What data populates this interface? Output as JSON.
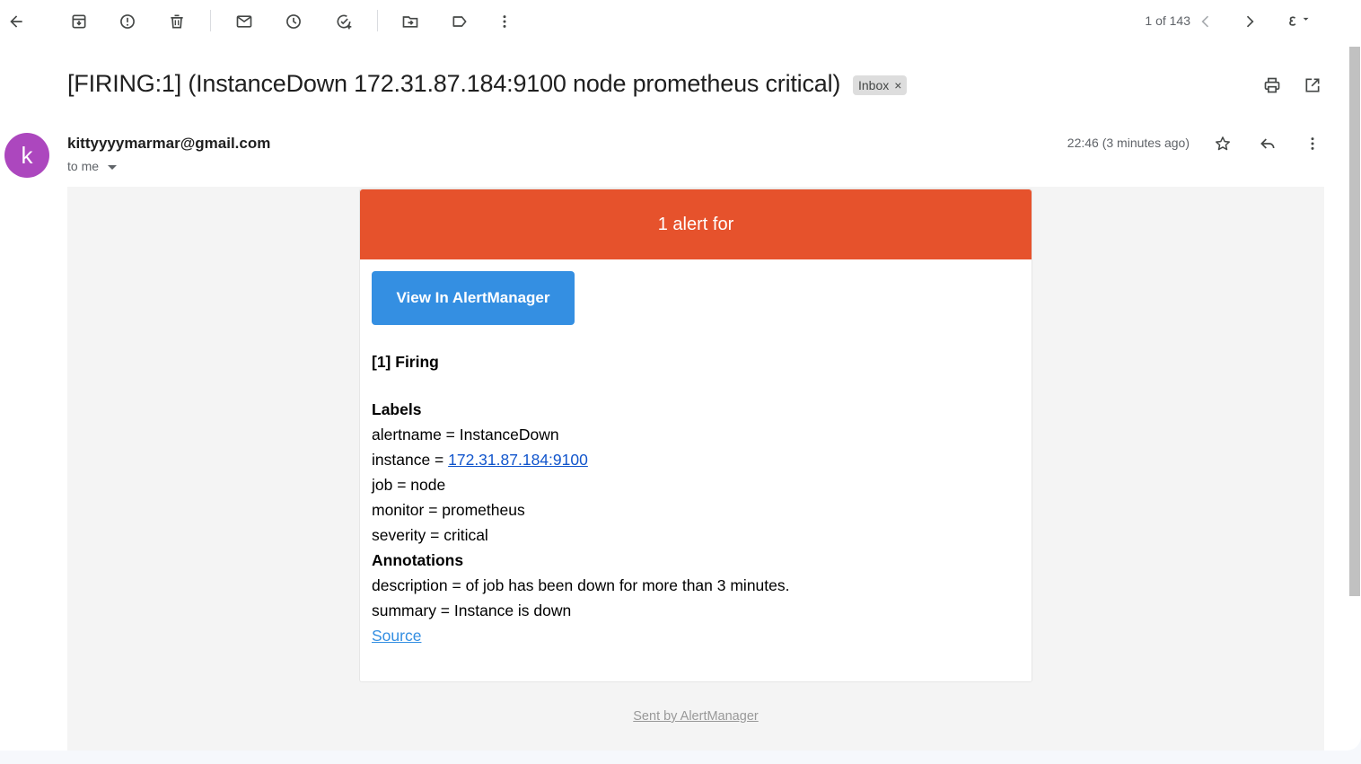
{
  "toolbar": {
    "pager": "1 of 143",
    "icons": [
      "back-arrow-icon",
      "archive-icon",
      "report-spam-icon",
      "delete-icon",
      "mark-unread-icon",
      "snooze-icon",
      "add-task-icon",
      "move-to-icon",
      "label-icon",
      "more-vert-icon",
      "chevron-left-icon",
      "chevron-right-icon",
      "input-tools-icon"
    ]
  },
  "message": {
    "subject": "[FIRING:1] (InstanceDown 172.31.87.184:9100 node prometheus critical)",
    "label": "Inbox",
    "label_remove": "×",
    "avatar_letter": "k",
    "sender": "kittyyyymarmar@gmail.com",
    "recipient": "to me",
    "timestamp": "22:46 (3 minutes ago)"
  },
  "alert": {
    "header": "1 alert for",
    "button": "View In AlertManager",
    "firing": "[1] Firing",
    "labels_heading": "Labels",
    "alertname": "alertname = InstanceDown",
    "instance_prefix": "instance = ",
    "instance_link": "172.31.87.184:9100",
    "job": "job = node",
    "monitor": "monitor = prometheus",
    "severity": "severity = critical",
    "annotations_heading": "Annotations",
    "description": "description = of job has been down for more than 3 minutes.",
    "summary": "summary = Instance is down",
    "source": "Source",
    "footer": "Sent by AlertManager"
  },
  "colors": {
    "alert_header": "#e6522c",
    "button": "#348fe2",
    "avatar": "#ac47be",
    "link": "#1155cc"
  }
}
